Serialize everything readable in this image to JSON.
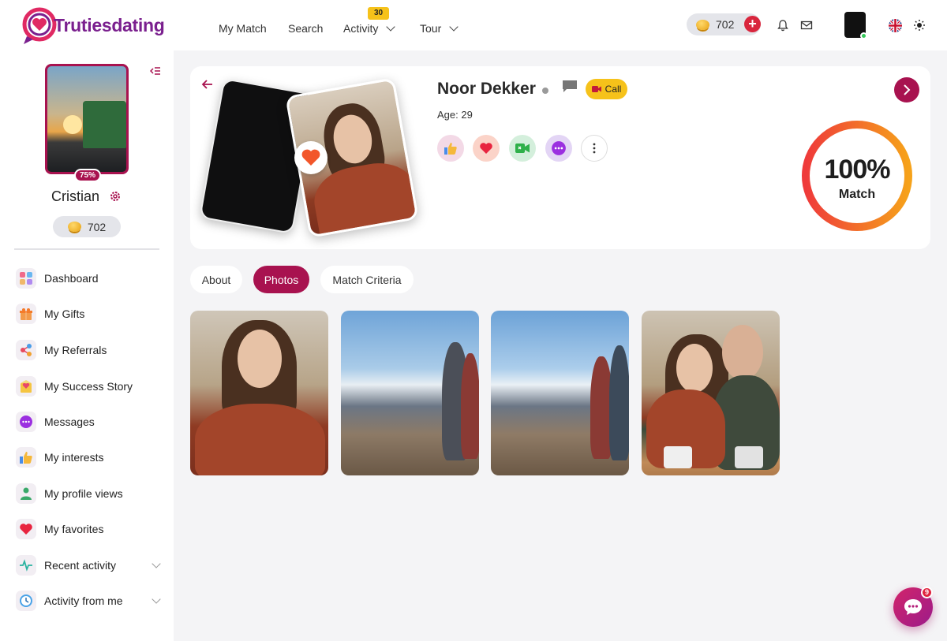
{
  "header": {
    "logo_text": "Trutiesdating",
    "nav": [
      {
        "label": "My Match"
      },
      {
        "label": "Search"
      },
      {
        "label": "Activity",
        "badge": "30"
      },
      {
        "label": "Tour"
      }
    ],
    "coins": "702",
    "plus_symbol": "+"
  },
  "sidebar": {
    "profile_completion": "75%",
    "username": "Cristian",
    "coins": "702",
    "menu": [
      {
        "label": "Dashboard",
        "icon": "dashboard-icon"
      },
      {
        "label": "My Gifts",
        "icon": "gift-icon"
      },
      {
        "label": "My Referrals",
        "icon": "share-icon"
      },
      {
        "label": "My Success Story",
        "icon": "success-story-icon"
      },
      {
        "label": "Messages",
        "icon": "messages-icon"
      },
      {
        "label": "My interests",
        "icon": "thumbs-up-icon"
      },
      {
        "label": "My profile views",
        "icon": "person-icon"
      },
      {
        "label": "My favorites",
        "icon": "heart-icon"
      },
      {
        "label": "Recent activity",
        "icon": "activity-icon"
      },
      {
        "label": "Activity from me",
        "icon": "clock-icon"
      }
    ]
  },
  "profile": {
    "name": "Noor Dekker",
    "call_label": "Call",
    "age": "Age: 29",
    "match_percent": "100%",
    "match_label": "Match",
    "match_fraction": 1.0
  },
  "tabs": [
    {
      "label": "About",
      "active": false
    },
    {
      "label": "Photos",
      "active": true
    },
    {
      "label": "Match Criteria",
      "active": false
    }
  ],
  "chat_fab": {
    "badge": "9"
  },
  "colors": {
    "brand": "#a8124f",
    "accent_yellow": "#f6c21a",
    "match_ring_start": "#ef3a3a",
    "match_ring_end": "#f6a21a"
  }
}
